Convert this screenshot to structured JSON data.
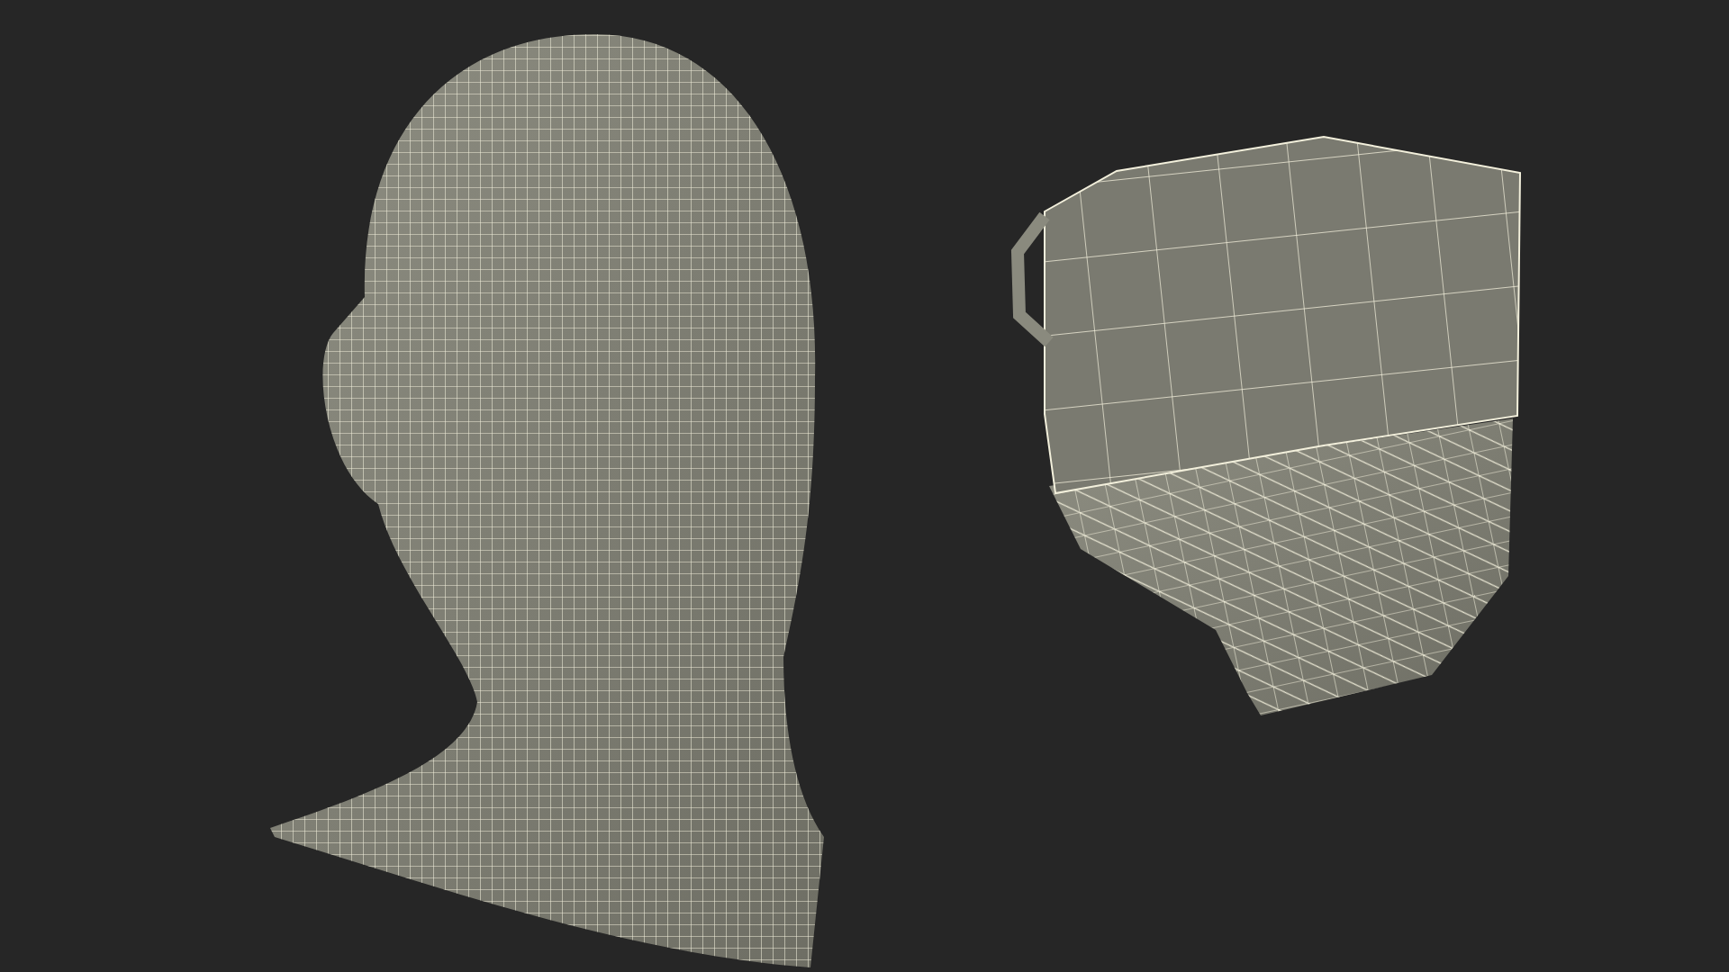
{
  "models": [
    {
      "kind": "head"
    },
    {
      "kind": "shield_mask"
    }
  ]
}
